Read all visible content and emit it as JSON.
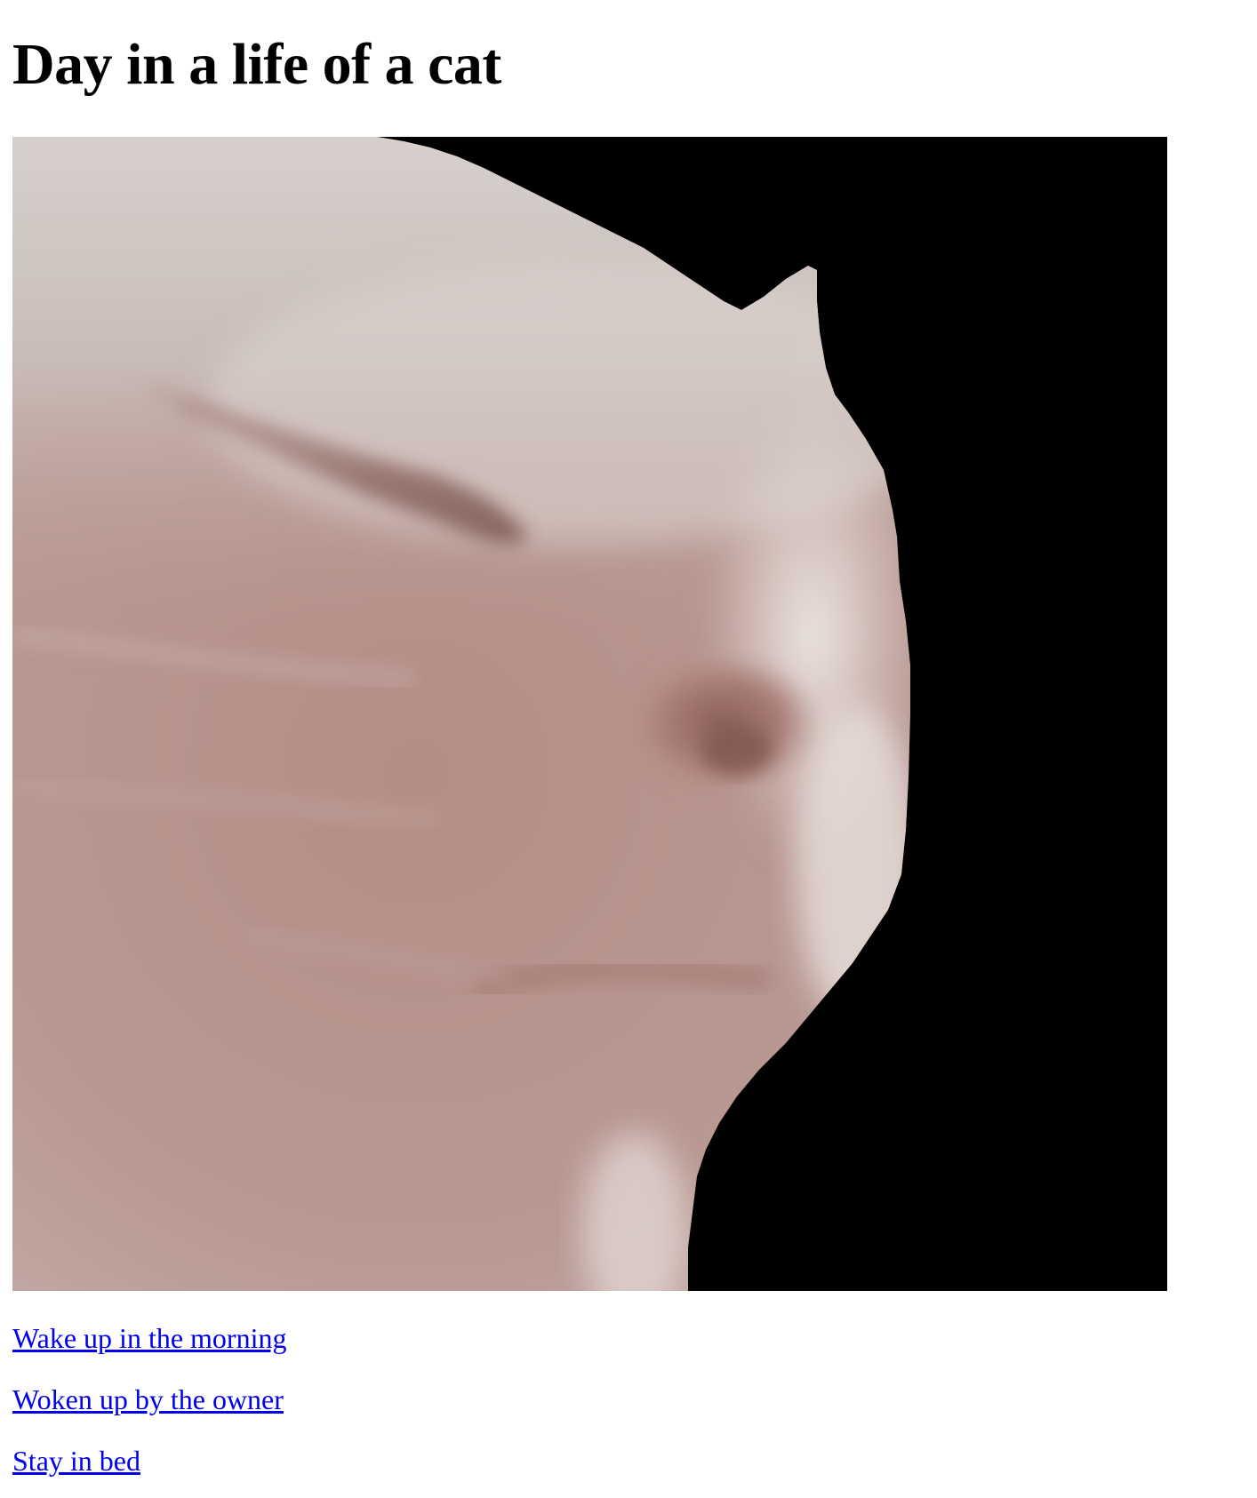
{
  "page": {
    "title": "Day in a life of a cat"
  },
  "image": {
    "alt": "cat"
  },
  "links": [
    {
      "label": "Wake up in the morning"
    },
    {
      "label": "Woken up by the owner"
    },
    {
      "label": "Stay in bed"
    }
  ],
  "colors": {
    "link": "#0000ee",
    "background": "#ffffff",
    "text": "#000000",
    "image_background": "#000000"
  }
}
